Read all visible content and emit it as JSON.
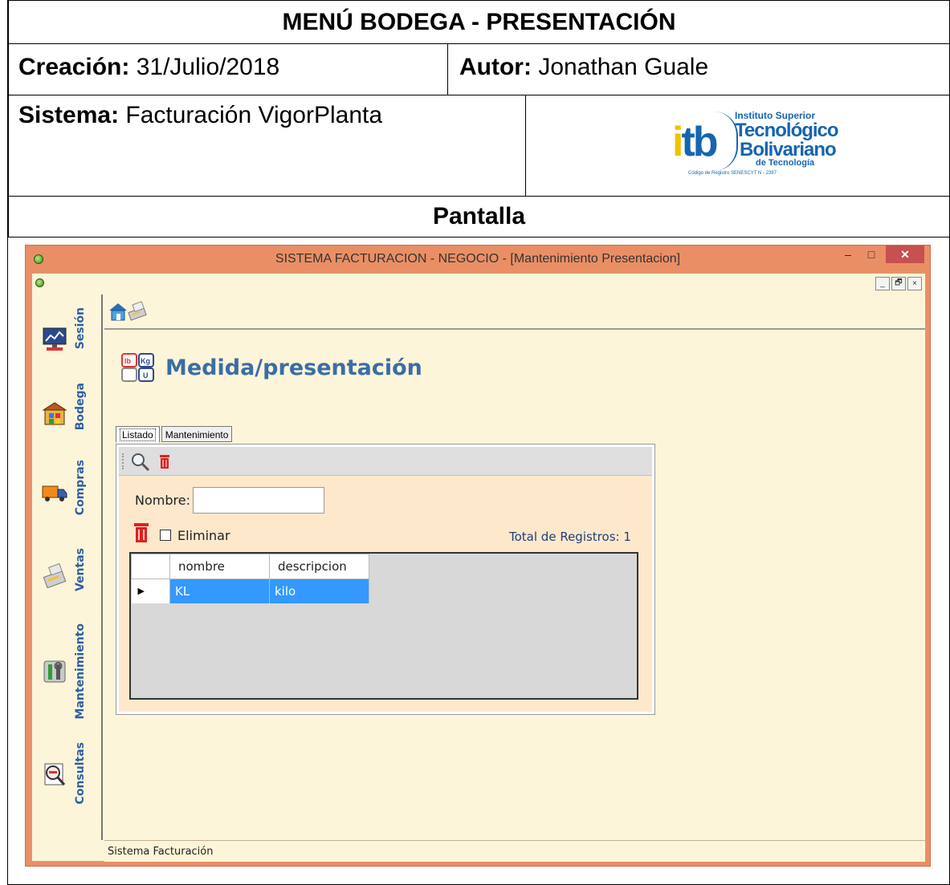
{
  "document": {
    "title": "MENÚ BODEGA - PRESENTACIÓN",
    "creacion_label": "Creación:",
    "creacion_value": "31/Julio/2018",
    "autor_label": "Autor:",
    "autor_value": "Jonathan Guale",
    "sistema_label": "Sistema:",
    "sistema_value": "Facturación VigorPlanta",
    "pantalla": "Pantalla",
    "logo": {
      "mark": "itb",
      "line1": "Instituto Superior",
      "line2": "Tecnológico",
      "line3": "Bolivariano",
      "line4": "de Tecnología",
      "line5": "Código de Registro SENESCYT N - 2397"
    }
  },
  "window": {
    "title": "SISTEMA FACTURACION - NEGOCIO - [Mantenimiento Presentacion]",
    "minimize": "–",
    "maximize": "□",
    "close": "✕",
    "mdi_min": "_",
    "mdi_restore": "🗗",
    "mdi_close": "×"
  },
  "nav": {
    "items": [
      {
        "label": "Sesión",
        "icon": "monitor-chart-icon"
      },
      {
        "label": "Bodega",
        "icon": "warehouse-icon"
      },
      {
        "label": "Compras",
        "icon": "truck-icon"
      },
      {
        "label": "Ventas",
        "icon": "cash-register-icon"
      },
      {
        "label": "Mantenimiento",
        "icon": "tools-icon"
      },
      {
        "label": "Consultas",
        "icon": "magnifier-report-icon"
      }
    ]
  },
  "toolbar": {
    "icons": [
      "home-icon",
      "printer-icon"
    ]
  },
  "form": {
    "title": "Medida/presentación",
    "title_icon": "units-icon",
    "tabs": [
      "Listado",
      "Mantenimiento"
    ],
    "active_tab": "Listado",
    "subtoolbar_icons": [
      "search-icon",
      "trash-icon"
    ],
    "nombre_label": "Nombre:",
    "nombre_value": "",
    "eliminar_label": "Eliminar",
    "total_label": "Total de Registros: 1",
    "grid": {
      "columns": [
        "nombre",
        "descripcion"
      ],
      "rows": [
        {
          "nombre": "KL",
          "descripcion": "kilo",
          "selected": true
        }
      ],
      "row_marker": "▶"
    }
  },
  "status_bar": {
    "text": "Sistema Facturación"
  },
  "colors": {
    "window_frame": "#ea8f65",
    "close_button": "#c75050",
    "client_bg": "#fdf5d9",
    "panel_bg": "#fde8cc",
    "nav_text": "#2f5fa5",
    "title_text": "#3a6ea5",
    "selection": "#3399ff"
  }
}
